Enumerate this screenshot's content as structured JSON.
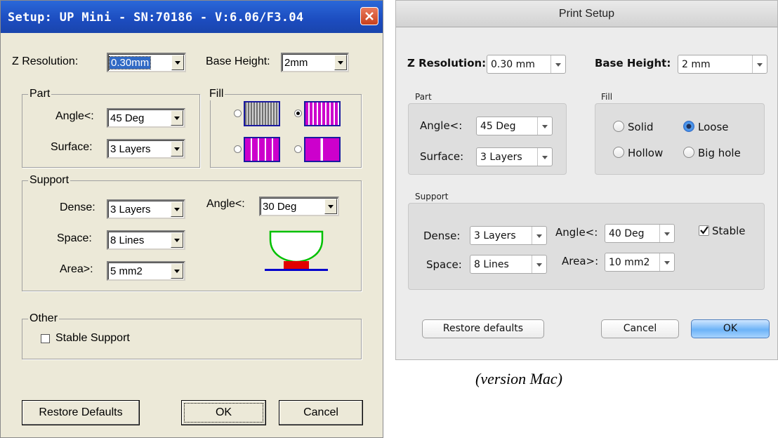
{
  "windows_dialog": {
    "title": "Setup: UP Mini - SN:70186 - V:6.06/F3.04",
    "z_resolution": {
      "label": "Z Resolution:",
      "value": "0.30mm"
    },
    "base_height": {
      "label": "Base Height:",
      "value": "2mm"
    },
    "part": {
      "title": "Part",
      "angle": {
        "label": "Angle<:",
        "value": "45 Deg"
      },
      "surface": {
        "label": "Surface:",
        "value": "3 Layers"
      }
    },
    "fill": {
      "title": "Fill",
      "selected_index": 1
    },
    "support": {
      "title": "Support",
      "dense": {
        "label": "Dense:",
        "value": "3 Layers"
      },
      "space": {
        "label": "Space:",
        "value": "8 Lines"
      },
      "area": {
        "label": "Area>:",
        "value": "5 mm2"
      },
      "angle": {
        "label": "Angle<:",
        "value": "30 Deg"
      }
    },
    "other": {
      "title": "Other",
      "stable_support": {
        "label": "Stable Support",
        "checked": false
      }
    },
    "buttons": {
      "restore": "Restore Defaults",
      "ok": "OK",
      "cancel": "Cancel"
    },
    "colors": {
      "title_bar": "#1c4cbf",
      "fill_pattern": "#cc00cc",
      "fill_border": "#1a1aa0",
      "support_red": "#e00000",
      "part_green": "#00c000",
      "base_blue": "#0000cc"
    }
  },
  "mac_dialog": {
    "title": "Print Setup",
    "z_resolution": {
      "label": "Z Resolution:",
      "value": "0.30 mm"
    },
    "base_height": {
      "label": "Base Height:",
      "value": "2 mm"
    },
    "part": {
      "title": "Part",
      "angle": {
        "label": "Angle<:",
        "value": "45 Deg"
      },
      "surface": {
        "label": "Surface:",
        "value": "3 Layers"
      }
    },
    "fill": {
      "title": "Fill",
      "options": [
        "Solid",
        "Loose",
        "Hollow",
        "Big hole"
      ],
      "selected": "Loose"
    },
    "support": {
      "title": "Support",
      "dense": {
        "label": "Dense:",
        "value": "3 Layers"
      },
      "space": {
        "label": "Space:",
        "value": "8 Lines"
      },
      "angle": {
        "label": "Angle<:",
        "value": "40 Deg"
      },
      "area": {
        "label": "Area>:",
        "value": "10 mm2"
      },
      "stable": {
        "label": "Stable",
        "checked": true
      }
    },
    "buttons": {
      "restore": "Restore defaults",
      "cancel": "Cancel",
      "ok": "OK"
    }
  },
  "caption": "(version Mac)"
}
